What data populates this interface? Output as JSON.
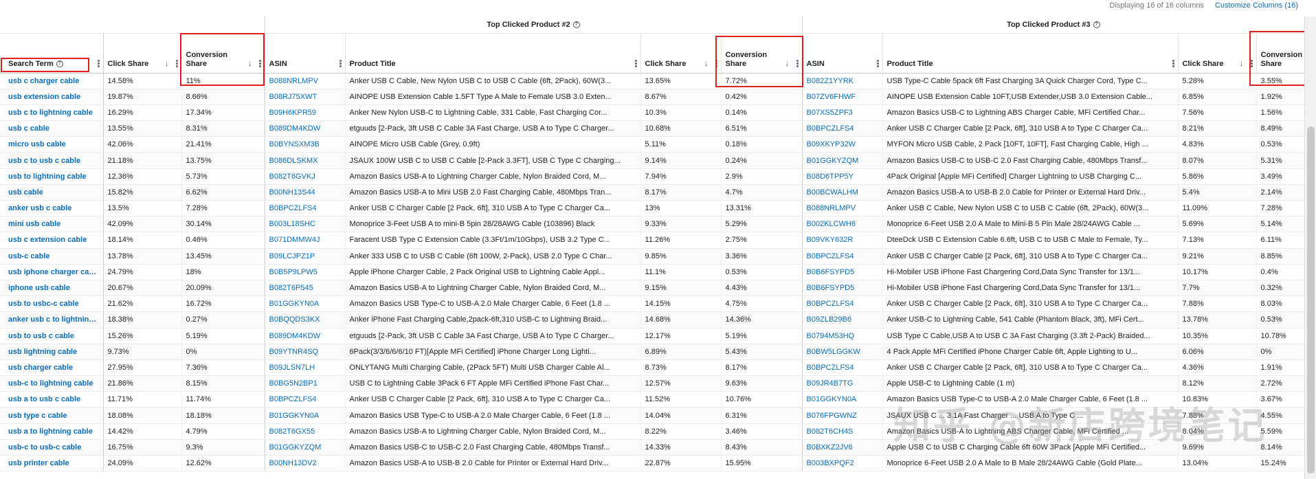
{
  "topbar": {
    "display_text": "Displaying 16 of 16 columns",
    "customize_label": "Customize Columns (16)"
  },
  "groups": {
    "g2": "Top Clicked Product #2",
    "g3": "Top Clicked Product #3"
  },
  "headers": {
    "search_term": "Search Term",
    "click_share": "Click Share",
    "conversion_share": "Conversion Share",
    "asin": "ASIN",
    "product_title": "Product Title",
    "conversion_short": "Conversion Share"
  },
  "rows": [
    {
      "term": "usb c charger cable",
      "p1_click": "14.58%",
      "p1_conv": "11%",
      "p2_asin": "B088NRLMPV",
      "p2_title": "Anker USB C Cable, New Nylon USB C to USB C Cable (6ft, 2Pack), 60W(3...",
      "p2_click": "13.65%",
      "p2_conv": "7.72%",
      "p3_asin": "B082Z1YYRK",
      "p3_title": "USB Type-C Cable 5pack 6ft Fast Charging 3A Quick Charger Cord, Type C...",
      "p3_click": "5.28%",
      "p3_conv": "3.55%"
    },
    {
      "term": "usb extension cable",
      "p1_click": "19.87%",
      "p1_conv": "8.66%",
      "p2_asin": "B08RJ75XWT",
      "p2_title": "AINOPE USB Extension Cable 1.5FT Type A Male to Female USB 3.0 Exten...",
      "p2_click": "8.67%",
      "p2_conv": "0.42%",
      "p3_asin": "B07ZV6FHWF",
      "p3_title": "AINOPE USB Extension Cable 10FT,USB Extender,USB 3.0 Extension Cable...",
      "p3_click": "6.85%",
      "p3_conv": "1.92%"
    },
    {
      "term": "usb c to lightning cable",
      "p1_click": "16.29%",
      "p1_conv": "17.34%",
      "p2_asin": "B09H6KPR59",
      "p2_title": "Anker New Nylon USB-C to Lightning Cable, 331 Cable, Fast Charging Cor...",
      "p2_click": "10.3%",
      "p2_conv": "0.14%",
      "p3_asin": "B07XS5ZPF3",
      "p3_title": "Amazon Basics USB-C to Lightning ABS Charger Cable, MFi Certified Char...",
      "p3_click": "7.56%",
      "p3_conv": "1.56%"
    },
    {
      "term": "usb c cable",
      "p1_click": "13.55%",
      "p1_conv": "8.31%",
      "p2_asin": "B089DM4KDW",
      "p2_title": "etguuds [2-Pack, 3ft USB C Cable 3A Fast Charge, USB A to Type C Charger...",
      "p2_click": "10.68%",
      "p2_conv": "6.51%",
      "p3_asin": "B0BPCZLFS4",
      "p3_title": "Anker USB C Charger Cable [2 Pack, 6ft], 310 USB A to Type C Charger Ca...",
      "p3_click": "8.21%",
      "p3_conv": "8.49%"
    },
    {
      "term": "micro usb cable",
      "p1_click": "42.06%",
      "p1_conv": "21.41%",
      "p2_asin": "B0BYNSXM3B",
      "p2_title": "AINOPE Micro USB Cable (Grey, 0.9ft)",
      "p2_click": "5.11%",
      "p2_conv": "0.18%",
      "p3_asin": "B09XKYP32W",
      "p3_title": "MYFON Micro USB Cable, 2 Pack [10FT, 10FT], Fast Charging Cable, High ...",
      "p3_click": "4.83%",
      "p3_conv": "0.53%"
    },
    {
      "term": "usb c to usb c cable",
      "p1_click": "21.18%",
      "p1_conv": "13.75%",
      "p2_asin": "B086DLSKMX",
      "p2_title": "JSAUX 100W USB C to USB C Cable [2-Pack 3.3FT], USB C Type C Charging...",
      "p2_click": "9.14%",
      "p2_conv": "0.24%",
      "p3_asin": "B01GGKYZQM",
      "p3_title": "Amazon Basics USB-C to USB-C 2.0 Fast Charging Cable, 480Mbps Transf...",
      "p3_click": "8.07%",
      "p3_conv": "5.31%"
    },
    {
      "term": "usb to lightning cable",
      "p1_click": "12.36%",
      "p1_conv": "5.73%",
      "p2_asin": "B082T6GVKJ",
      "p2_title": "Amazon Basics USB-A to Lightning Charger Cable, Nylon Braided Cord, M...",
      "p2_click": "7.94%",
      "p2_conv": "2.9%",
      "p3_asin": "B08D6TPP5Y",
      "p3_title": "4Pack Original [Apple MFi Certified] Charger Lightning to USB Charging C...",
      "p3_click": "5.86%",
      "p3_conv": "3.49%"
    },
    {
      "term": "usb cable",
      "p1_click": "15.82%",
      "p1_conv": "6.62%",
      "p2_asin": "B00NH13S44",
      "p2_title": "Amazon Basics USB-A to Mini USB 2.0 Fast Charging Cable, 480Mbps Tran...",
      "p2_click": "8.17%",
      "p2_conv": "4.7%",
      "p3_asin": "B00BCWALHM",
      "p3_title": "Amazon Basics USB-A to USB-B 2.0 Cable for Printer or External Hard Driv...",
      "p3_click": "5.4%",
      "p3_conv": "2.14%"
    },
    {
      "term": "anker usb c cable",
      "p1_click": "13.5%",
      "p1_conv": "7.28%",
      "p2_asin": "B0BPCZLFS4",
      "p2_title": "Anker USB C Charger Cable [2 Pack, 6ft], 310 USB A to Type C Charger Ca...",
      "p2_click": "13%",
      "p2_conv": "13.31%",
      "p3_asin": "B088NRLMPV",
      "p3_title": "Anker USB C Cable, New Nylon USB C to USB C Cable (6ft, 2Pack), 60W(3...",
      "p3_click": "11.09%",
      "p3_conv": "7.28%"
    },
    {
      "term": "mini usb cable",
      "p1_click": "42.09%",
      "p1_conv": "30.14%",
      "p2_asin": "B003L18SHC",
      "p2_title": "Monoprice 3-Feet USB A to mini-B 5pin 28/28AWG Cable (103896) Black",
      "p2_click": "9.33%",
      "p2_conv": "5.29%",
      "p3_asin": "B002KLCWH6",
      "p3_title": "Monoprice 6-Feet USB 2.0 A Male to Mini-B 5 Pin Male 28/24AWG Cable ...",
      "p3_click": "5.69%",
      "p3_conv": "5.14%"
    },
    {
      "term": "usb c extension cable",
      "p1_click": "18.14%",
      "p1_conv": "0.46%",
      "p2_asin": "B071DMMW4J",
      "p2_title": "Faracent USB Type C Extension Cable (3.3Ft/1m/10Gbps), USB 3.2 Type C...",
      "p2_click": "11.26%",
      "p2_conv": "2.75%",
      "p3_asin": "B09VKY632R",
      "p3_title": "DteeDck USB C Extension Cable 6.6ft, USB C to USB C Male to Female, Ty...",
      "p3_click": "7.13%",
      "p3_conv": "6.11%"
    },
    {
      "term": "usb-c cable",
      "p1_click": "13.78%",
      "p1_conv": "13.45%",
      "p2_asin": "B09LCJPZ1P",
      "p2_title": "Anker 333 USB C to USB C Cable (6ft 100W, 2-Pack), USB 2.0 Type C Char...",
      "p2_click": "9.85%",
      "p2_conv": "3.36%",
      "p3_asin": "B0BPCZLFS4",
      "p3_title": "Anker USB C Charger Cable [2 Pack, 6ft], 310 USB A to Type C Charger Ca...",
      "p3_click": "9.21%",
      "p3_conv": "8.85%"
    },
    {
      "term": "usb iphone charger cable",
      "p1_click": "24.79%",
      "p1_conv": "18%",
      "p2_asin": "B0B5P9LPW5",
      "p2_title": "Apple iPhone Charger Cable, 2 Pack Original USB to Lightning Cable Appl...",
      "p2_click": "11.1%",
      "p2_conv": "0.53%",
      "p3_asin": "B0B6FSYPD5",
      "p3_title": "Hi-Mobiler USB iPhone Fast Chargering Cord,Data Sync Transfer for 13/1...",
      "p3_click": "10.17%",
      "p3_conv": "0.4%"
    },
    {
      "term": "iphone usb cable",
      "p1_click": "20.67%",
      "p1_conv": "20.09%",
      "p2_asin": "B082T6P545",
      "p2_title": "Amazon Basics USB-A to Lightning Charger Cable, Nylon Braided Cord, M...",
      "p2_click": "9.15%",
      "p2_conv": "4.43%",
      "p3_asin": "B0B6FSYPD5",
      "p3_title": "Hi-Mobiler USB iPhone Fast Chargering Cord,Data Sync Transfer for 13/1...",
      "p3_click": "7.7%",
      "p3_conv": "0.32%"
    },
    {
      "term": "usb to usbc-c cable",
      "p1_click": "21.62%",
      "p1_conv": "16.72%",
      "p2_asin": "B01GGKYN0A",
      "p2_title": "Amazon Basics USB Type-C to USB-A 2.0 Male Charger Cable, 6 Feet (1.8 ...",
      "p2_click": "14.15%",
      "p2_conv": "4.75%",
      "p3_asin": "B0BPCZLFS4",
      "p3_title": "Anker USB C Charger Cable [2 Pack, 6ft], 310 USB A to Type C Charger Ca...",
      "p3_click": "7.88%",
      "p3_conv": "8.03%"
    },
    {
      "term": "anker usb c to lightning c",
      "p1_click": "18.38%",
      "p1_conv": "0.27%",
      "p2_asin": "B0BQQDS3KX",
      "p2_title": "Anker iPhone Fast Charging Cable,2pack-6ft,310 USB-C to Lightning Braid...",
      "p2_click": "14.68%",
      "p2_conv": "14.36%",
      "p3_asin": "B09ZLB29B6",
      "p3_title": "Anker USB-C to Lightning Cable, 541 Cable (Phantom Black, 3ft), MFi Cert...",
      "p3_click": "13.78%",
      "p3_conv": "0.53%"
    },
    {
      "term": "usb to usb c cable",
      "p1_click": "15.26%",
      "p1_conv": "5.19%",
      "p2_asin": "B089DM4KDW",
      "p2_title": "etguuds [2-Pack, 3ft USB C Cable 3A Fast Charge, USB A to Type C Charger...",
      "p2_click": "12.17%",
      "p2_conv": "5.19%",
      "p3_asin": "B0794M53HQ",
      "p3_title": "USB Type C Cable,USB A to USB C 3A Fast Charging (3.3ft 2-Pack) Braided...",
      "p3_click": "10.35%",
      "p3_conv": "10.78%"
    },
    {
      "term": "usb lightning cable",
      "p1_click": "9.73%",
      "p1_conv": "0%",
      "p2_asin": "B09YTNR4SQ",
      "p2_title": "6Pack(3/3/6/6/6/10 FT)[Apple MFi Certified] iPhone Charger Long Lighti...",
      "p2_click": "6.89%",
      "p2_conv": "5.43%",
      "p3_asin": "B0BW5LGGKW",
      "p3_title": "4 Pack Apple MFi Certified iPhone Charger Cable 6ft, Apple Lighting to U...",
      "p3_click": "6.06%",
      "p3_conv": "0%"
    },
    {
      "term": "usb charger cable",
      "p1_click": "27.95%",
      "p1_conv": "7.36%",
      "p2_asin": "B09JLSN7LH",
      "p2_title": "ONLYTANG Multi Charging Cable, (2Pack 5FT) Multi USB Charger Cable Al...",
      "p2_click": "8.73%",
      "p2_conv": "8.17%",
      "p3_asin": "B0BPCZLFS4",
      "p3_title": "Anker USB C Charger Cable [2 Pack, 6ft], 310 USB A to Type C Charger Ca...",
      "p3_click": "4.36%",
      "p3_conv": "1.91%"
    },
    {
      "term": "usb-c to lightning cable",
      "p1_click": "21.86%",
      "p1_conv": "8.15%",
      "p2_asin": "B0BG5N2BP1",
      "p2_title": "USB C to Lightning Cable 3Pack 6 FT Apple MFi Certified iPhone Fast Char...",
      "p2_click": "12.57%",
      "p2_conv": "9.63%",
      "p3_asin": "B09JR4B7TG",
      "p3_title": "Apple USB-C to Lightning Cable (1 m)",
      "p3_click": "8.12%",
      "p3_conv": "2.72%"
    },
    {
      "term": "usb a to usb c cable",
      "p1_click": "11.71%",
      "p1_conv": "11.74%",
      "p2_asin": "B0BPCZLFS4",
      "p2_title": "Anker USB C Charger Cable [2 Pack, 6ft], 310 USB A to Type C Charger Ca...",
      "p2_click": "11.52%",
      "p2_conv": "10.76%",
      "p3_asin": "B01GGKYN0A",
      "p3_title": "Amazon Basics USB Type-C to USB-A 2.0 Male Charger Cable, 6 Feet (1.8 ...",
      "p3_click": "10.83%",
      "p3_conv": "3.67%"
    },
    {
      "term": "usb type c cable",
      "p1_click": "18.08%",
      "p1_conv": "18.18%",
      "p2_asin": "B01GGKYN0A",
      "p2_title": "Amazon Basics USB Type-C to USB-A 2.0 Male Charger Cable, 6 Feet (1.8 ...",
      "p2_click": "14.04%",
      "p2_conv": "6.31%",
      "p3_asin": "B076FPGWNZ",
      "p3_title": "JSAUX USB C ... 3.1A Fast Charger ... USB A to Type C ...",
      "p3_click": "7.88%",
      "p3_conv": "4.55%"
    },
    {
      "term": "usb a to lightning cable",
      "p1_click": "14.42%",
      "p1_conv": "4.79%",
      "p2_asin": "B082T6GX55",
      "p2_title": "Amazon Basics USB-A to Lightning Charger Cable, Nylon Braided Cord, M...",
      "p2_click": "8.22%",
      "p2_conv": "3.46%",
      "p3_asin": "B082T6CH4S",
      "p3_title": "Amazon Basics USB-A to Lightning ABS Charger Cable, MFi Certified ...",
      "p3_click": "8.04%",
      "p3_conv": "5.59%"
    },
    {
      "term": "usb-c to usb-c cable",
      "p1_click": "16.75%",
      "p1_conv": "9.3%",
      "p2_asin": "B01GGKYZQM",
      "p2_title": "Amazon Basics USB-C to USB-C 2.0 Fast Charging Cable, 480Mbps Transf...",
      "p2_click": "14.33%",
      "p2_conv": "8.43%",
      "p3_asin": "B0BXKZ2JV6",
      "p3_title": "Apple USB C to USB C Charging Cable 6ft 60W 3Pack [Apple MFi Certified...",
      "p3_click": "9.69%",
      "p3_conv": "8.14%"
    },
    {
      "term": "usb printer cable",
      "p1_click": "24.09%",
      "p1_conv": "12.62%",
      "p2_asin": "B00NH13DV2",
      "p2_title": "Amazon Basics USB-A to USB-B 2.0 Cable for Printer or External Hard Driv...",
      "p2_click": "22.87%",
      "p2_conv": "15.95%",
      "p3_asin": "B003BXPQF2",
      "p3_title": "Monoprice 6-Feet USB 2.0 A Male to B Male 28/24AWG Cable (Gold Plate...",
      "p3_click": "13.04%",
      "p3_conv": "15.24%"
    }
  ],
  "watermark": "知乎 @新店跨境笔记",
  "colors": {
    "link": "#0a6ebd",
    "highlight": "#e0201a"
  }
}
